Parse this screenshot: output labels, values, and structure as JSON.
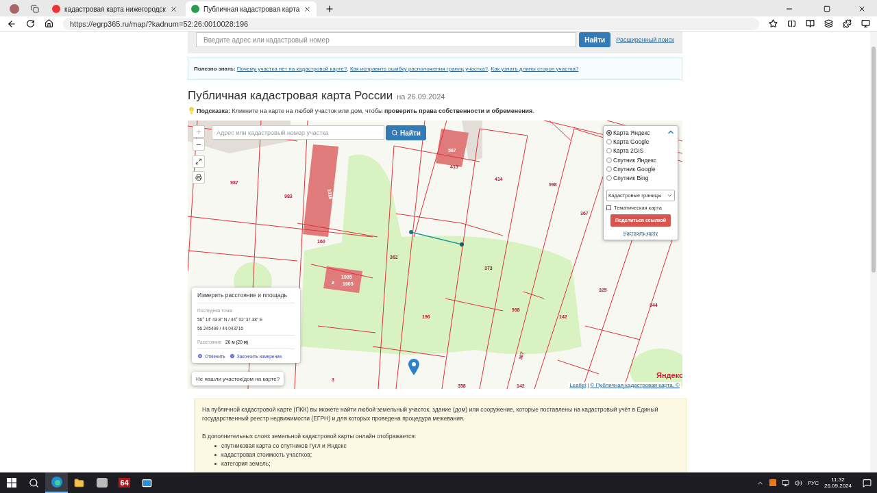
{
  "browser": {
    "tabs": [
      {
        "title": "кадастровая карта нижегородск",
        "selected": false
      },
      {
        "title": "Публичная кадастровая карта",
        "selected": true
      }
    ],
    "url": "https://egrp365.ru/map/?kadnum=52:26:0010028:196"
  },
  "search": {
    "placeholder": "Введите адрес или кадастровый номер",
    "button": "Найти",
    "advanced_link": "Расширенный поиск"
  },
  "info": {
    "label": "Полезно знать:",
    "links": [
      "Почему участка нет на кадастровой карте?",
      "Как исправить ошибку расположения границ участка?",
      "Как узнать длины сторон участка?"
    ],
    "separator": ","
  },
  "heading": {
    "title": "Публичная кадастровая карта России",
    "date": "на 26.09.2024"
  },
  "hint": "**Подсказка:** Кликните на карте на любой участок или дом, чтобы **проверить права собственности и обременения**.",
  "map": {
    "search_placeholder": "Адрес или кадастровый номер участка",
    "search_button": "Найти",
    "zoom_in": "+",
    "zoom_out": "−",
    "layers": [
      {
        "label": "Карта Яндекс",
        "selected": true
      },
      {
        "label": "Карта Google",
        "selected": false
      },
      {
        "label": "Карта 2GIS",
        "selected": false
      },
      {
        "label": "Спутник Яндекс",
        "selected": false
      },
      {
        "label": "Спутник Google",
        "selected": false
      },
      {
        "label": "Спутник Bing",
        "selected": false
      }
    ],
    "layer_select": "Кадастровые границы",
    "thematic": {
      "label": "Тематическая карта",
      "checked": false
    },
    "share_button": "Поделиться ссылкой",
    "settings_link": "Настроить карту",
    "parcel_labels": [
      "987",
      "983",
      "1016",
      "160",
      "567",
      "415",
      "414",
      "998",
      "367",
      "362",
      "373",
      "2",
      "1005",
      "1005",
      "196",
      "998",
      "325",
      "344",
      "142",
      "367",
      "3",
      "358",
      "142"
    ],
    "measure": {
      "title": "Измерить расстояние и площадь",
      "last_point_label": "Последняя точка",
      "dms": "56° 14' 43.8\" N / 44° 02' 37.38\" E",
      "decimal": "56.245499 / 44.043716",
      "distance_label": "Расстояние",
      "distance_value": "20 м (20 м)",
      "cancel": "Отменить",
      "finish": "Закончить измерение"
    },
    "not_found": "Не нашли участок/дом на карте?",
    "logo": "Яндекс",
    "attribution": {
      "leaflet": "Leaflet",
      "separator": "|",
      "source": "© Публичная кадастровая карта, ©"
    }
  },
  "article": {
    "paragraph": "На публичной кадастровой карте (ПКК) вы можете найти любой земельный участок, здание (дом) или сооружение, которые поставлены на кадастровый учёт в Единый государственный реестр недвижимости (ЕГРН) и для которых проведена процедура межевания.",
    "list_intro": "В дополнительных слоях земельной кадастровой карты онлайн отображается:",
    "items": [
      "спутниковая карта со спутников Гугл и Яндекс",
      "кадастровая стоимость участков;",
      "категория земель;"
    ]
  },
  "taskbar": {
    "badge": "64",
    "lang": "РУС",
    "time": "11:32",
    "date": "26.09.2024"
  }
}
